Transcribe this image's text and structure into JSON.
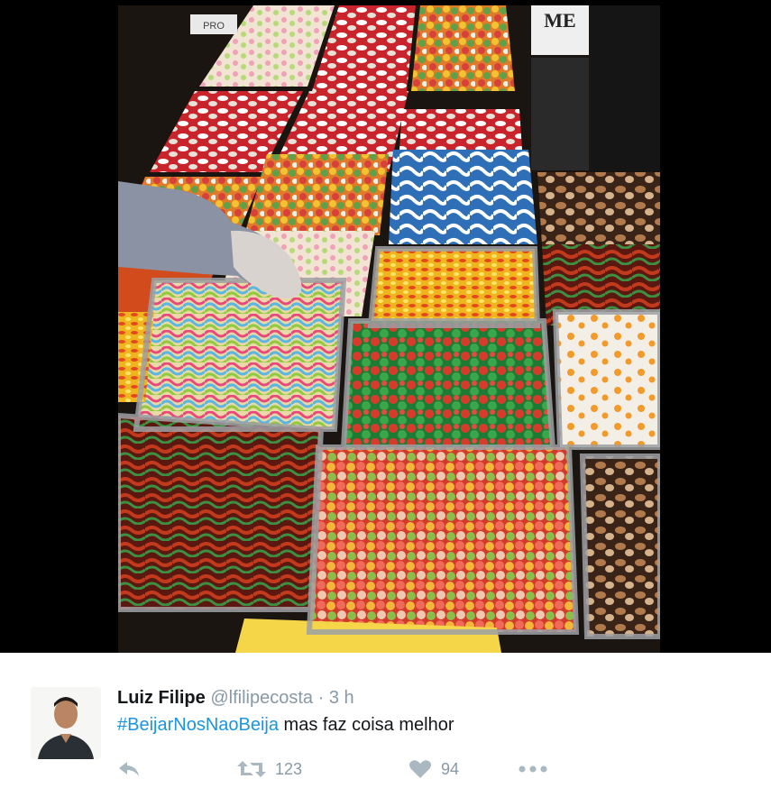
{
  "photo": {
    "description_alt": "",
    "shop_sign": "ME",
    "sign_text": "PRO"
  },
  "tweet": {
    "author_name": "Luiz Filipe",
    "author_handle": "@lfilipecosta",
    "separator": "·",
    "timestamp": "3 h",
    "hashtag": "#BeijarNosNaoBeija",
    "text_rest": " mas faz coisa melhor",
    "retweet_count": "123",
    "like_count": "94"
  },
  "icons": {
    "reply": "reply-icon",
    "retweet": "retweet-icon",
    "like": "heart-icon",
    "more": "more-dots-icon"
  },
  "colors": {
    "hashtag": "#1b95e0",
    "muted": "#8899a6",
    "icon": "#aab8c2",
    "text": "#14171a"
  }
}
